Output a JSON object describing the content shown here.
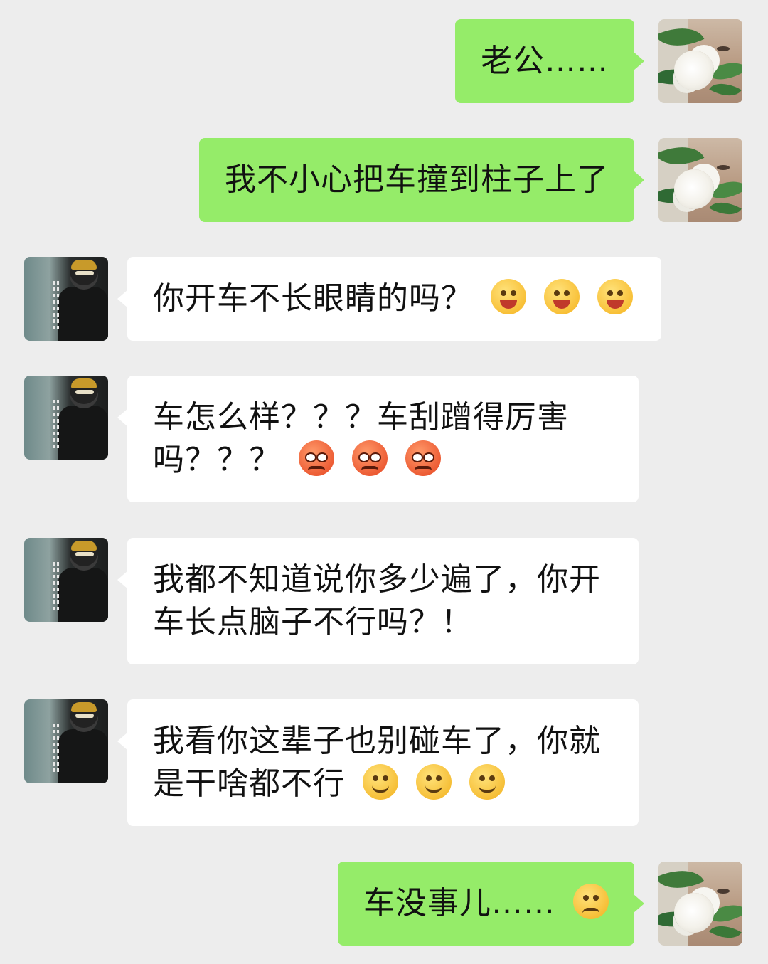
{
  "messages": [
    {
      "side": "self",
      "text": "老公……",
      "emojis": []
    },
    {
      "side": "self",
      "text": "我不小心把车撞到柱子上了",
      "emojis": []
    },
    {
      "side": "other",
      "text": "你开车不长眼睛的吗？",
      "emojis": [
        "squinting-tongue-emoji",
        "squinting-tongue-emoji",
        "squinting-tongue-emoji"
      ]
    },
    {
      "side": "other",
      "text": "车怎么样？？？车刮蹭得厉害吗？？？",
      "emojis": [
        "angry-face-emoji",
        "angry-face-emoji",
        "angry-face-emoji"
      ]
    },
    {
      "side": "other",
      "text": "我都不知道说你多少遍了，你开车长点脑子不行吗？！",
      "emojis": []
    },
    {
      "side": "other",
      "text": "我看你这辈子也别碰车了，你就是干啥都不行",
      "emojis": [
        "slight-smile-emoji",
        "slight-smile-emoji",
        "slight-smile-emoji"
      ]
    },
    {
      "side": "self",
      "text": "车没事儿……",
      "emojis": [
        "pensive-face-emoji"
      ]
    }
  ],
  "colors": {
    "background": "#ededed",
    "self_bubble": "#95ec69",
    "other_bubble": "#ffffff",
    "text": "#111111"
  }
}
